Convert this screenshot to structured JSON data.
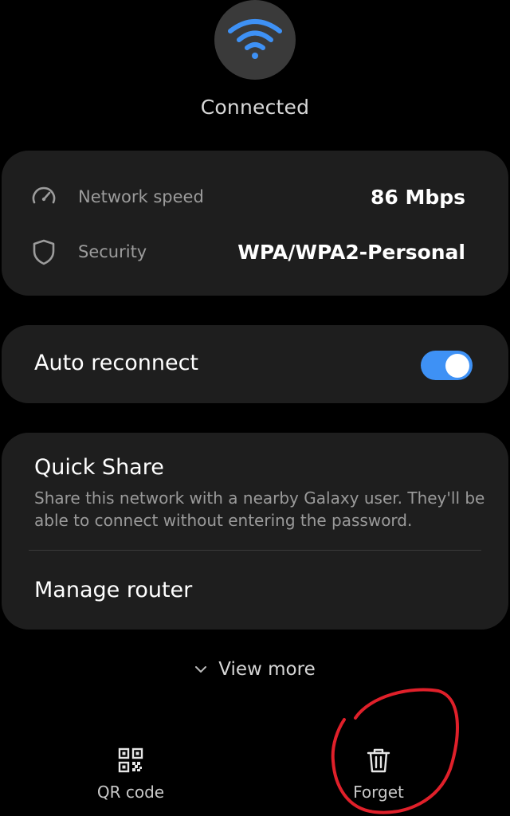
{
  "header": {
    "status": "Connected",
    "icon": "wifi-icon",
    "accent_color": "#3e91f5"
  },
  "info": {
    "speed_label": "Network speed",
    "speed_value": "86 Mbps",
    "speed_icon": "speedometer-icon",
    "security_label": "Security",
    "security_value": "WPA/WPA2-Personal",
    "security_icon": "shield-icon"
  },
  "auto_reconnect": {
    "label": "Auto reconnect",
    "enabled": true
  },
  "quick_share": {
    "title": "Quick Share",
    "description": "Share this network with a nearby Galaxy user. They'll be able to connect without entering the password."
  },
  "manage_router": {
    "label": "Manage router"
  },
  "view_more": {
    "label": "View more",
    "icon": "chevron-down-icon"
  },
  "bottom_bar": {
    "qr_label": "QR code",
    "qr_icon": "qr-code-icon",
    "forget_label": "Forget",
    "forget_icon": "trash-icon"
  },
  "annotation": {
    "color": "#e0202a"
  }
}
